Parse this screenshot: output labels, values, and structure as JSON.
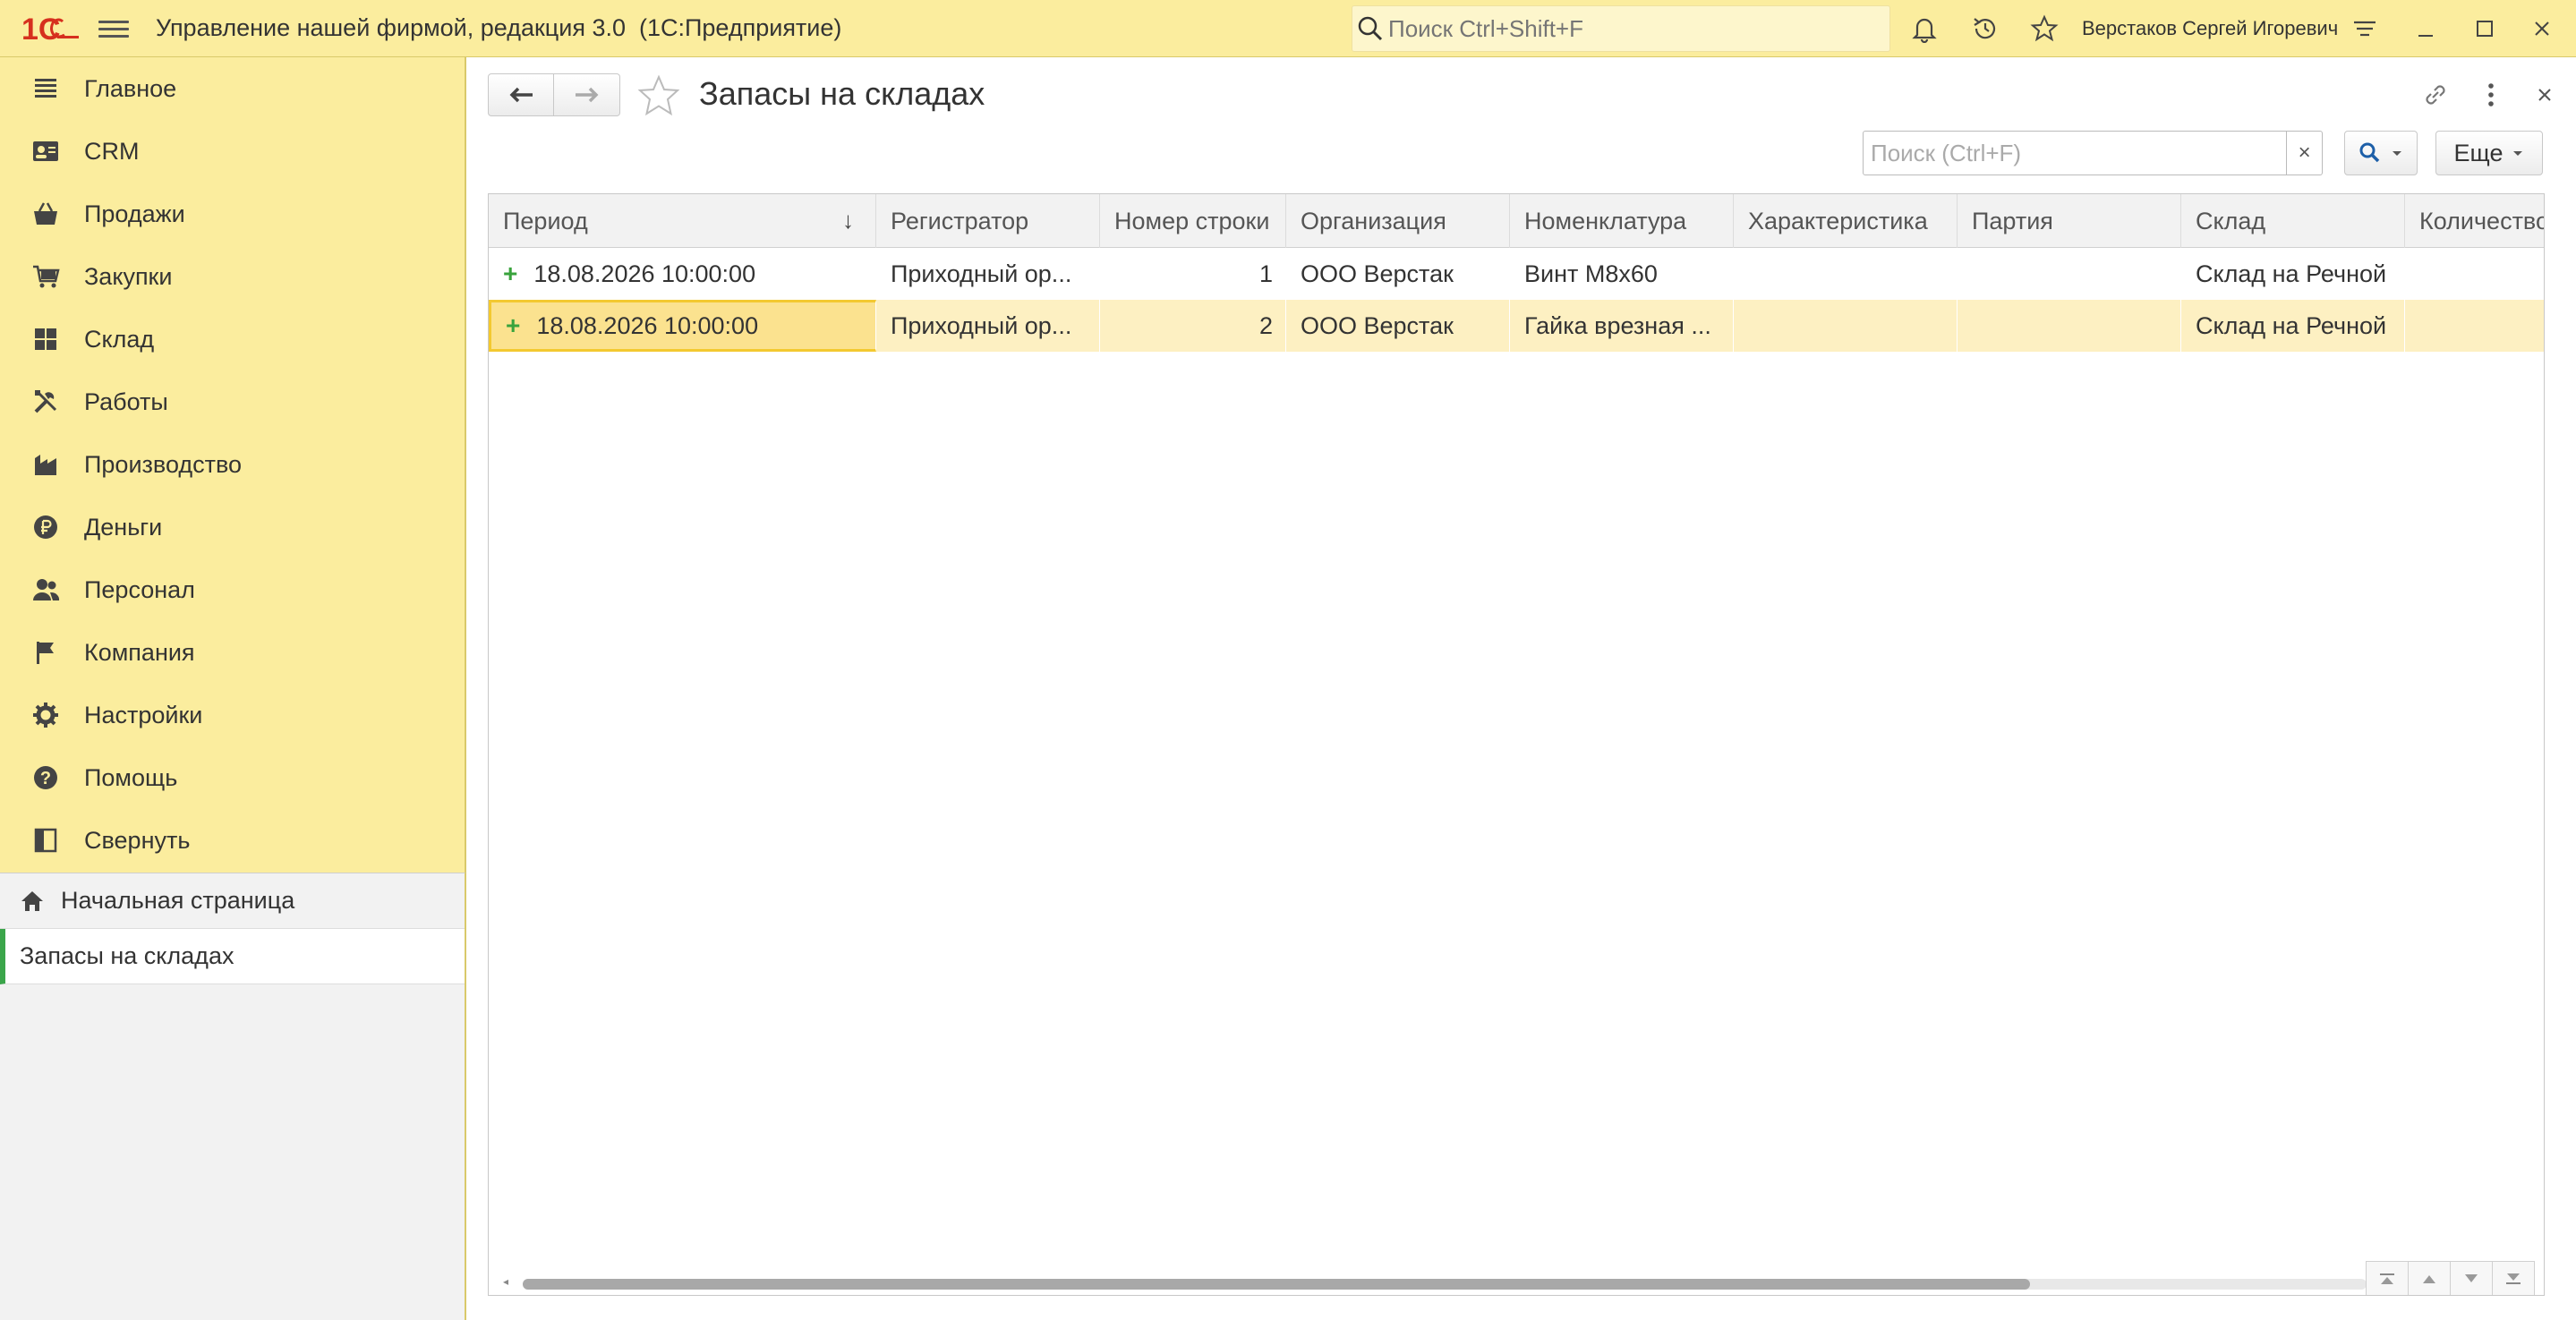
{
  "app": {
    "title": "Управление нашей фирмой, редакция 3.0  (1С:Предприятие)",
    "search_placeholder": "Поиск Ctrl+Shift+F",
    "user": "Верстаков Сергей Игоревич",
    "accent_color": "#fbed9e"
  },
  "sidebar": {
    "items": [
      {
        "label": "Главное",
        "icon": "list-icon"
      },
      {
        "label": "CRM",
        "icon": "crm-icon"
      },
      {
        "label": "Продажи",
        "icon": "basket-icon"
      },
      {
        "label": "Закупки",
        "icon": "cart-icon"
      },
      {
        "label": "Склад",
        "icon": "warehouse-icon"
      },
      {
        "label": "Работы",
        "icon": "tools-icon"
      },
      {
        "label": "Производство",
        "icon": "factory-icon"
      },
      {
        "label": "Деньги",
        "icon": "ruble-icon"
      },
      {
        "label": "Персонал",
        "icon": "people-icon"
      },
      {
        "label": "Компания",
        "icon": "flag-icon"
      },
      {
        "label": "Настройки",
        "icon": "gear-icon"
      },
      {
        "label": "Помощь",
        "icon": "help-icon"
      },
      {
        "label": "Свернуть",
        "icon": "collapse-icon"
      }
    ]
  },
  "open_windows": {
    "home": "Начальная страница",
    "active": "Запасы на складах"
  },
  "main": {
    "title": "Запасы на складах",
    "search_placeholder": "Поиск (Ctrl+F)",
    "clear": "×",
    "more_label": "Еще"
  },
  "table": {
    "columns": [
      {
        "label": "Период",
        "sort": "↓"
      },
      {
        "label": "Регистратор"
      },
      {
        "label": "Номер строки"
      },
      {
        "label": "Организация"
      },
      {
        "label": "Номенклатура"
      },
      {
        "label": "Характеристика"
      },
      {
        "label": "Партия"
      },
      {
        "label": "Склад"
      },
      {
        "label": "Количество"
      }
    ],
    "rows": [
      {
        "mark": "+",
        "period": "18.08.2026 10:00:00",
        "registrar": "Приходный ор...",
        "line": "1",
        "org": "ООО Верстак",
        "item": "Винт М8х60",
        "characteristic": "",
        "batch": "",
        "warehouse": "Склад на Речной",
        "qty": ""
      },
      {
        "mark": "+",
        "period": "18.08.2026 10:00:00",
        "registrar": "Приходный ор...",
        "line": "2",
        "org": "ООО Верстак",
        "item": "Гайка врезная ...",
        "characteristic": "",
        "batch": "",
        "warehouse": "Склад на Речной",
        "qty": ""
      }
    ]
  }
}
